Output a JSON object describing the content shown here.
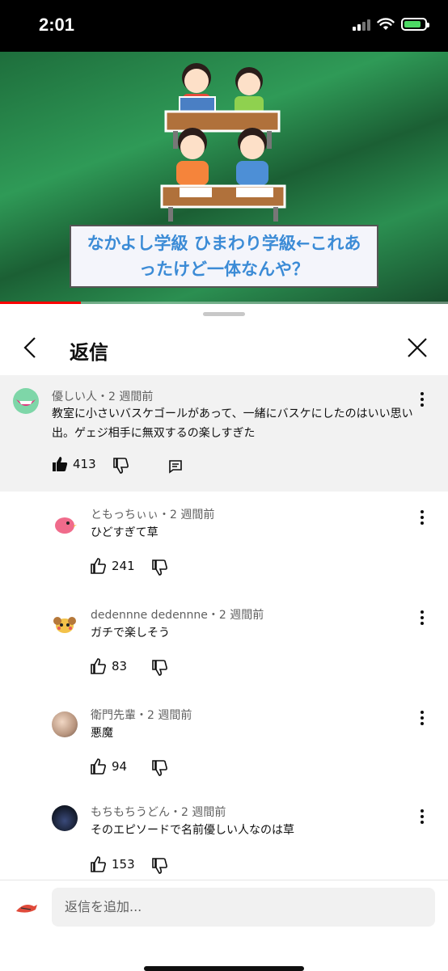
{
  "status_bar": {
    "time": "2:01"
  },
  "video": {
    "caption": "なかよし学級 ひまわり学級←これあったけど一体なんや？",
    "progress": 0.18
  },
  "panel": {
    "title": "返信"
  },
  "parent_comment": {
    "author": "優しい人",
    "age": "2 週間前",
    "text": "教室に小さいバスケゴールがあって、一緒にバスケにしたのはいい思い出。ゲェジ相手に無双するの楽しすぎた",
    "likes": "413"
  },
  "separator": "・",
  "replies": [
    {
      "author": "ともっちぃぃ",
      "age": "2 週間前",
      "text": "ひどすぎて草",
      "likes": "241"
    },
    {
      "author": "dedennne dedennne",
      "age": "2 週間前",
      "text": "ガチで楽しそう",
      "likes": "83"
    },
    {
      "author": "衛門先輩",
      "age": "2 週間前",
      "text": "悪魔",
      "likes": "94"
    },
    {
      "author": "もちもちうどん",
      "age": "2 週間前",
      "text": "そのエピソードで名前優しい人なのは草",
      "likes": "153"
    }
  ],
  "reply_input": {
    "placeholder": "返信を追加..."
  },
  "colors": {
    "like_icon": "#0f0f0f",
    "caption_text": "#3b8bd6",
    "video_bg": "#2f9a57"
  }
}
